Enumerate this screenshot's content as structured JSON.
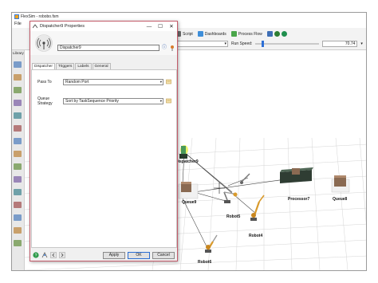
{
  "app": {
    "title": "FlexSim - robobo.fsm",
    "menu_first": "File",
    "toolbar": {
      "script": "Script",
      "dashboards": "Dashboards",
      "process_flow": "Process Flow",
      "run_speed_label": "Run Speed:",
      "run_speed_value": "70.74",
      "run_speed_fraction": 0.1
    },
    "library_label": "Library"
  },
  "dialog": {
    "title": "Dispatcher9 Properties",
    "name_value": "Dispatcher9",
    "tabs": [
      "Dispatcher",
      "Triggers",
      "Labels",
      "General"
    ],
    "active_tab": "Dispatcher",
    "properties": [
      {
        "label": "Pass To",
        "value": "Random Port"
      },
      {
        "label": "Queue Strategy",
        "value": "Sort by TaskSequence Priority"
      }
    ],
    "buttons": {
      "apply": "Apply",
      "ok": "OK",
      "cancel": "Cancel"
    }
  },
  "view3d": {
    "objects": {
      "dispatcher": "Dispatcher9",
      "queue9": "Queue9",
      "robot5": "Robot5",
      "robot4": "Robot4",
      "robot6": "Robot6",
      "processor7": "Processor7",
      "queue8": "Queue8"
    }
  },
  "colors": {
    "dialog_border": "#c45b6a",
    "accent_blue": "#2d6fd6",
    "conveyor": "#2f3d33",
    "box": "#8a6a52",
    "robot": "#d99a2b"
  }
}
